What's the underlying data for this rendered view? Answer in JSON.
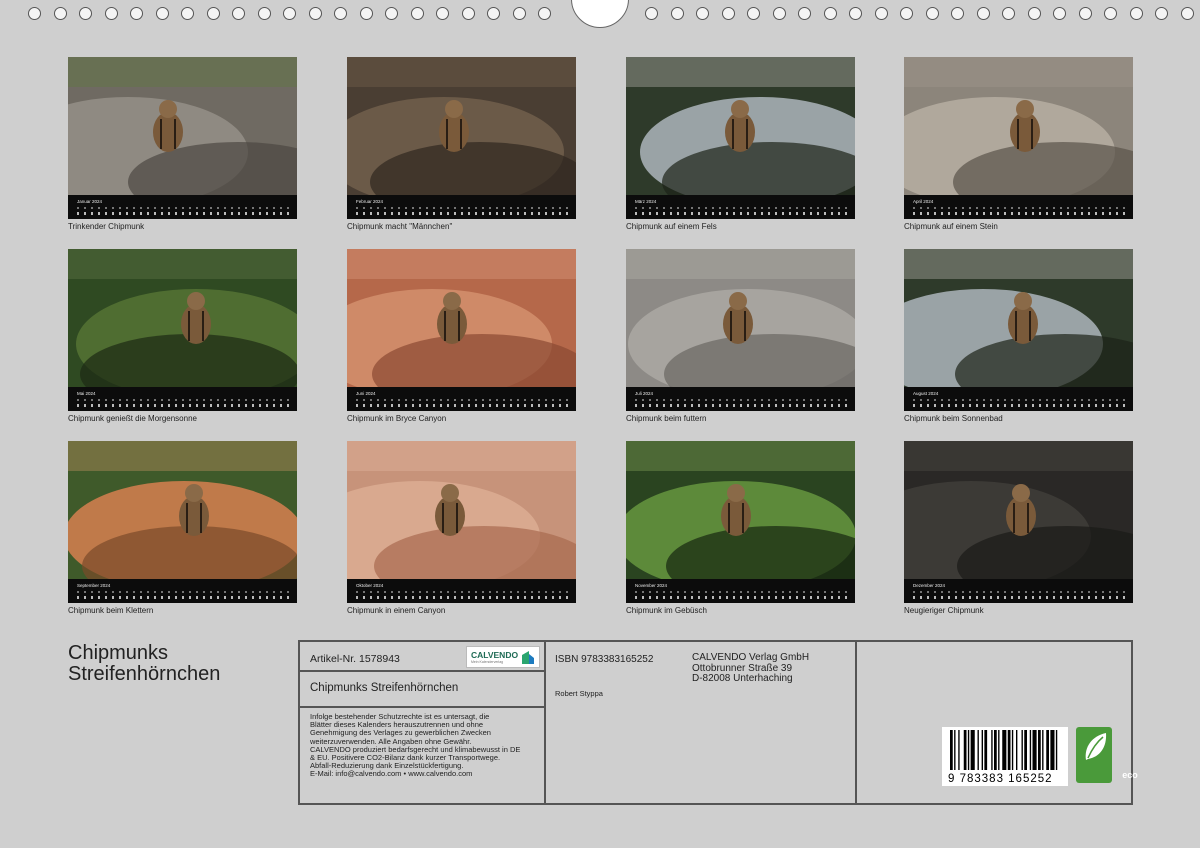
{
  "months": [
    {
      "label": "Januar 2024",
      "caption": "Trinkender Chipmunk",
      "scene": "rock-grey"
    },
    {
      "label": "Februar 2024",
      "caption": "Chipmunk macht \"Männchen\"",
      "scene": "dirt"
    },
    {
      "label": "März 2024",
      "caption": "Chipmunk auf einem Fels",
      "scene": "forest-rock"
    },
    {
      "label": "April 2024",
      "caption": "Chipmunk auf einem Stein",
      "scene": "stones"
    },
    {
      "label": "Mai 2024",
      "caption": "Chipmunk genießt die Morgensonne",
      "scene": "bushes"
    },
    {
      "label": "Juni 2024",
      "caption": "Chipmunk im Bryce Canyon",
      "scene": "red-rock"
    },
    {
      "label": "Juli 2024",
      "caption": "Chipmunk beim futtern",
      "scene": "granite"
    },
    {
      "label": "August 2024",
      "caption": "Chipmunk beim Sonnenbad",
      "scene": "forest-rock"
    },
    {
      "label": "September 2024",
      "caption": "Chipmunk beim Klettern",
      "scene": "orange-rock"
    },
    {
      "label": "Oktober 2024",
      "caption": "Chipmunk in einem Canyon",
      "scene": "sand"
    },
    {
      "label": "November 2024",
      "caption": "Chipmunk im Gebüsch",
      "scene": "green-leaves"
    },
    {
      "label": "Dezember 2024",
      "caption": "Neugieriger Chipmunk",
      "scene": "dark-ground"
    }
  ],
  "title": {
    "line1": "Chipmunks",
    "line2": "Streifenhörnchen"
  },
  "imprint": {
    "article": "Artikel-Nr. 1578943",
    "logo_text": "CALVENDO",
    "logo_sub": "Mein Kalenderverlag",
    "calendar_title": "Chipmunks Streifenhörnchen",
    "isbn": "ISBN 9783383165252",
    "author": "Robert Styppa",
    "publisher": [
      "CALVENDO Verlag GmbH",
      "Ottobrunner Straße 39",
      "D-82008 Unterhaching"
    ],
    "legal": [
      "Infolge bestehender Schutzrechte ist es untersagt, die",
      "Blätter dieses Kalenders herauszutrennen und ohne",
      "Genehmigung des Verlages zu gewerblichen Zwecken",
      "weiterzuverwenden. Alle Angaben ohne Gewähr.",
      "CALVENDO produziert bedarfsgerecht und klimabewusst in DE",
      "& EU. Positivere CO2-Bilanz dank kurzer Transportwege.",
      "Abfall-Reduzierung dank Einzelstückfertigung.",
      "E-Mail: info@calvendo.com • www.calvendo.com"
    ],
    "barcode_number": "9 783383 165252",
    "eco_label": "eco"
  },
  "colors": {
    "background": "#cfcfcf",
    "calbar": "#0c0c0c",
    "eco": "#4a9a3a",
    "brand": "#1e6b55"
  }
}
